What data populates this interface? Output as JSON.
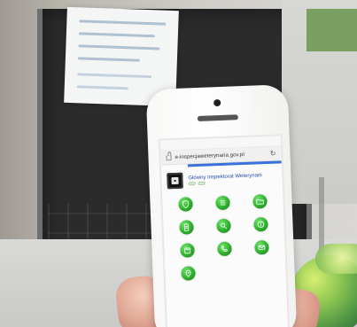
{
  "phone": {
    "statusbar": {
      "left": "",
      "center": "",
      "right": ""
    },
    "urlbar": {
      "url": "e-inspecjaweterynaria.gov.pl"
    },
    "header": {
      "title": "Główny Inspektorat Weterynarii",
      "badges": [
        "",
        ""
      ]
    },
    "menu": [
      {
        "label": "",
        "icon": "shield-icon"
      },
      {
        "label": "",
        "icon": "list-icon"
      },
      {
        "label": "",
        "icon": "folder-icon"
      },
      {
        "label": "",
        "icon": "document-icon"
      },
      {
        "label": "",
        "icon": "magnify-icon"
      },
      {
        "label": "",
        "icon": "info-icon"
      },
      {
        "label": "",
        "icon": "calendar-icon"
      },
      {
        "label": "",
        "icon": "phone-icon"
      },
      {
        "label": "",
        "icon": "mail-icon"
      },
      {
        "label": "",
        "icon": "map-icon"
      }
    ]
  }
}
